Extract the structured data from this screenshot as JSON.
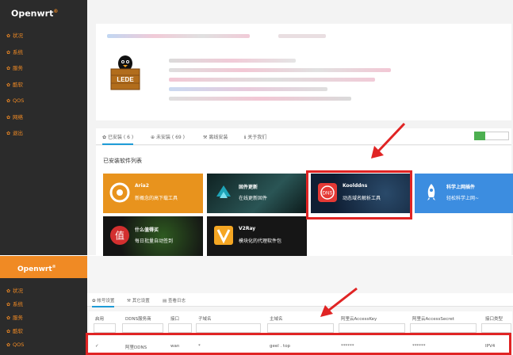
{
  "top": {
    "brand": "Openwrt",
    "menu": [
      {
        "icon": "home-icon",
        "glyph": "✿",
        "label": "状况"
      },
      {
        "icon": "gear-icon",
        "glyph": "✿",
        "label": "系统"
      },
      {
        "icon": "service-icon",
        "glyph": "✿",
        "label": "服务"
      },
      {
        "icon": "softcenter-icon",
        "glyph": "✿",
        "label": "酷软"
      },
      {
        "icon": "qos-icon",
        "glyph": "✿",
        "label": "QOS"
      },
      {
        "icon": "network-icon",
        "glyph": "✿",
        "label": "网络"
      },
      {
        "icon": "logout-icon",
        "glyph": "✿",
        "label": "退出"
      }
    ],
    "logo_text": "LEDE",
    "tabs": [
      {
        "icon": "✿",
        "label": "已安装 ( 6 )"
      },
      {
        "icon": "⊕",
        "label": "未安装 ( 69 )"
      },
      {
        "icon": "⚒",
        "label": "离线安装"
      },
      {
        "icon": "ℹ",
        "label": "关于我们"
      }
    ],
    "section_title": "已安装软件列表",
    "apps": [
      {
        "title": "Aria2",
        "sub": "新概念的高下载工具",
        "color": "#e8931d"
      },
      {
        "title": "固件更新",
        "sub": "在线更新固件",
        "color": "#1b3a3a"
      },
      {
        "title": "Koolddns",
        "sub": "动态域名解析工具",
        "color": "#16293f"
      },
      {
        "title": "科学上网插件",
        "sub": "轻松科学上网~",
        "color": "#3c8de0"
      },
      {
        "title": "什么值得买",
        "sub": "每日批量自动签到",
        "color": "#181818"
      },
      {
        "title": "V2Ray",
        "sub": "模块化的代理软件包",
        "color": "#161616"
      }
    ]
  },
  "bottom": {
    "brand": "Openwrt",
    "menu": [
      {
        "icon": "home-icon",
        "glyph": "✿",
        "label": "状况"
      },
      {
        "icon": "gear-icon",
        "glyph": "✿",
        "label": "系统"
      },
      {
        "icon": "service-icon",
        "glyph": "✿",
        "label": "服务"
      },
      {
        "icon": "softcenter-icon",
        "glyph": "✿",
        "label": "酷软"
      },
      {
        "icon": "qos-icon",
        "glyph": "✿",
        "label": "QOS"
      }
    ],
    "tabs": [
      {
        "icon": "✿",
        "label": "帐号设置"
      },
      {
        "icon": "⚒",
        "label": "其它设置"
      },
      {
        "icon": "▤",
        "label": "查看日志"
      }
    ],
    "headers": [
      "启用",
      "DDNS服务商",
      "接口",
      "子域名",
      "主域名",
      "阿里云AccessKey",
      "阿里云AccessSecret",
      "接口类型"
    ],
    "row": [
      "✓",
      "阿里DDNS",
      "wan",
      "*",
      "geel .  top",
      "******",
      "******",
      "IPV4"
    ]
  }
}
